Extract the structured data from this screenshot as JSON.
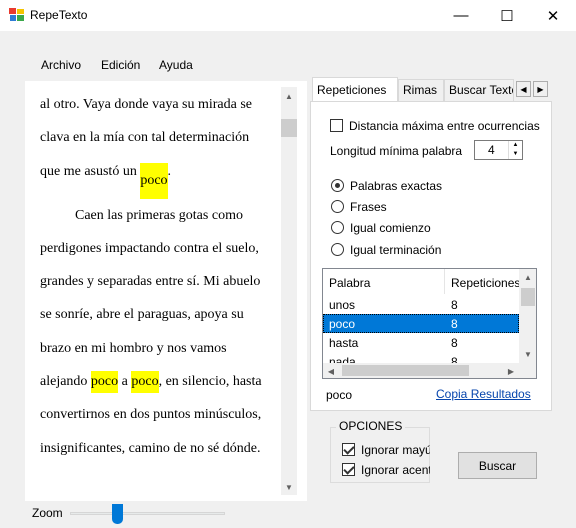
{
  "window": {
    "title": "RepeTexto",
    "minimize_icon": "—",
    "maximize_icon": "☐",
    "close_icon": "✕"
  },
  "menu": {
    "items": [
      "Archivo",
      "Edición",
      "Ayuda"
    ]
  },
  "editor": {
    "lines": [
      "al otro. Vaya donde vaya su mirada se",
      "clava en la mía con tal determinación",
      "que me asustó un ",
      "poco",
      ".",
      "Caen las primeras gotas como",
      "perdigones impactando contra el suelo,",
      "grandes y separadas entre sí. Mi abuelo",
      "se sonríe, abre el paraguas, apoya su",
      "brazo en mi hombro y nos vamos",
      "alejando ",
      "poco",
      " a ",
      "poco",
      ", en silencio, hasta",
      "convertirnos en dos puntos minúsculos,",
      "insignificantes, camino de no sé dónde."
    ],
    "highlight_color": "#ffff00"
  },
  "zoom": {
    "label": "Zoom",
    "level": 0.28
  },
  "tabs": {
    "items": [
      "Repeticiones",
      "Rimas",
      "Buscar Texto"
    ],
    "active": "Repeticiones",
    "scroll_left_icon": "◀",
    "scroll_right_icon": "▶"
  },
  "options": {
    "max_distance_label": "Distancia máxima entre ocurrencias",
    "max_distance_checked": false,
    "min_length_label": "Longitud mínima palabra",
    "min_length_value": "4",
    "radios": [
      {
        "label": "Palabras exactas",
        "checked": true
      },
      {
        "label": "Frases",
        "checked": false
      },
      {
        "label": "Igual comienzo",
        "checked": false
      },
      {
        "label": "Igual terminación",
        "checked": false
      }
    ]
  },
  "results": {
    "columns": [
      "Palabra",
      "Repeticiones"
    ],
    "rows": [
      {
        "word": "unos",
        "count": "8"
      },
      {
        "word": "poco",
        "count": "8"
      },
      {
        "word": "hasta",
        "count": "8"
      },
      {
        "word": "nada",
        "count": "8"
      }
    ],
    "selected_index": 1,
    "selected_word": "poco",
    "copy_label": "Copia Resultados"
  },
  "group": {
    "title": "OPCIONES",
    "ignore_case_label": "Ignorar mayúsculas",
    "ignore_case_checked": true,
    "ignore_accents_label": "Ignorar acentos",
    "ignore_accents_checked": true
  },
  "search_button": "Buscar",
  "colors": {
    "accent": "#0078d7",
    "link": "#0645ad",
    "highlight": "#ffff00"
  }
}
